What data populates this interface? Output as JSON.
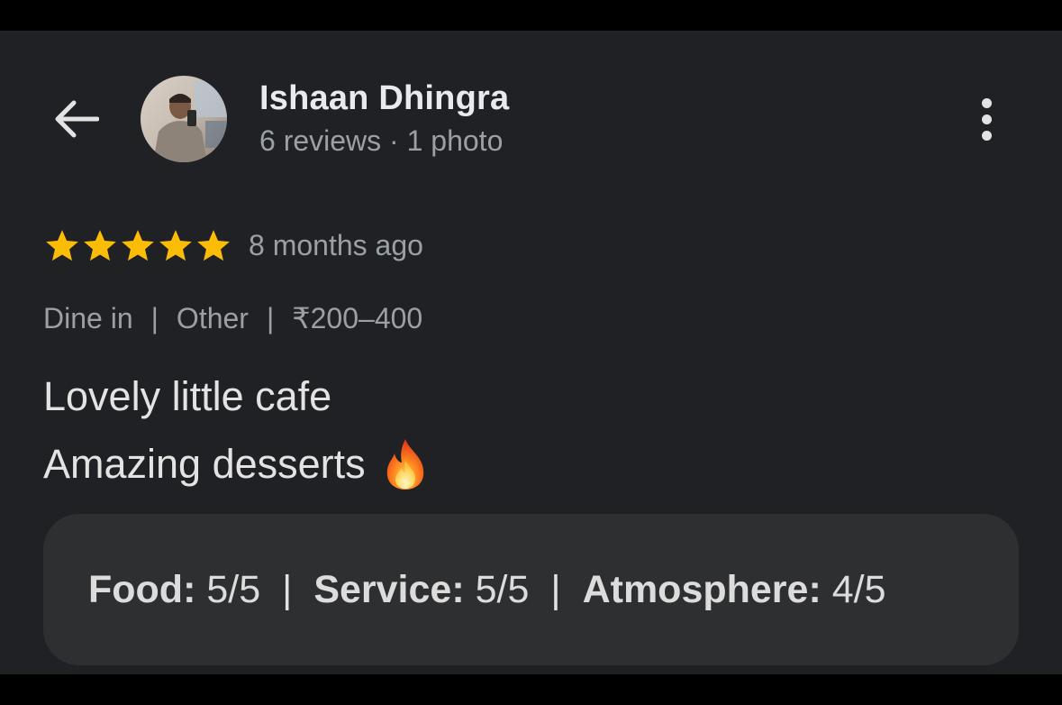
{
  "reviewer": {
    "name": "Ishaan Dhingra",
    "stats": "6 reviews · 1 photo"
  },
  "review": {
    "stars": 5,
    "max_stars": 5,
    "time": "8 months ago",
    "tags": [
      "Dine in",
      "Other",
      "₹200–400"
    ],
    "text_line1": "Lovely little cafe",
    "text_line2": "Amazing desserts"
  },
  "ratings": [
    {
      "label": "Food",
      "value": "5/5"
    },
    {
      "label": "Service",
      "value": "5/5"
    },
    {
      "label": "Atmosphere",
      "value": "4/5"
    }
  ],
  "icons": {
    "back": "arrow-back-icon",
    "more": "more-vertical-icon",
    "star": "star-icon",
    "fire": "fire-emoji"
  },
  "colors": {
    "background": "#202124",
    "star": "#FBBC04",
    "text_primary": "#e8eaed",
    "text_secondary": "#9aa0a6",
    "ratings_box": "#2e2f31"
  }
}
